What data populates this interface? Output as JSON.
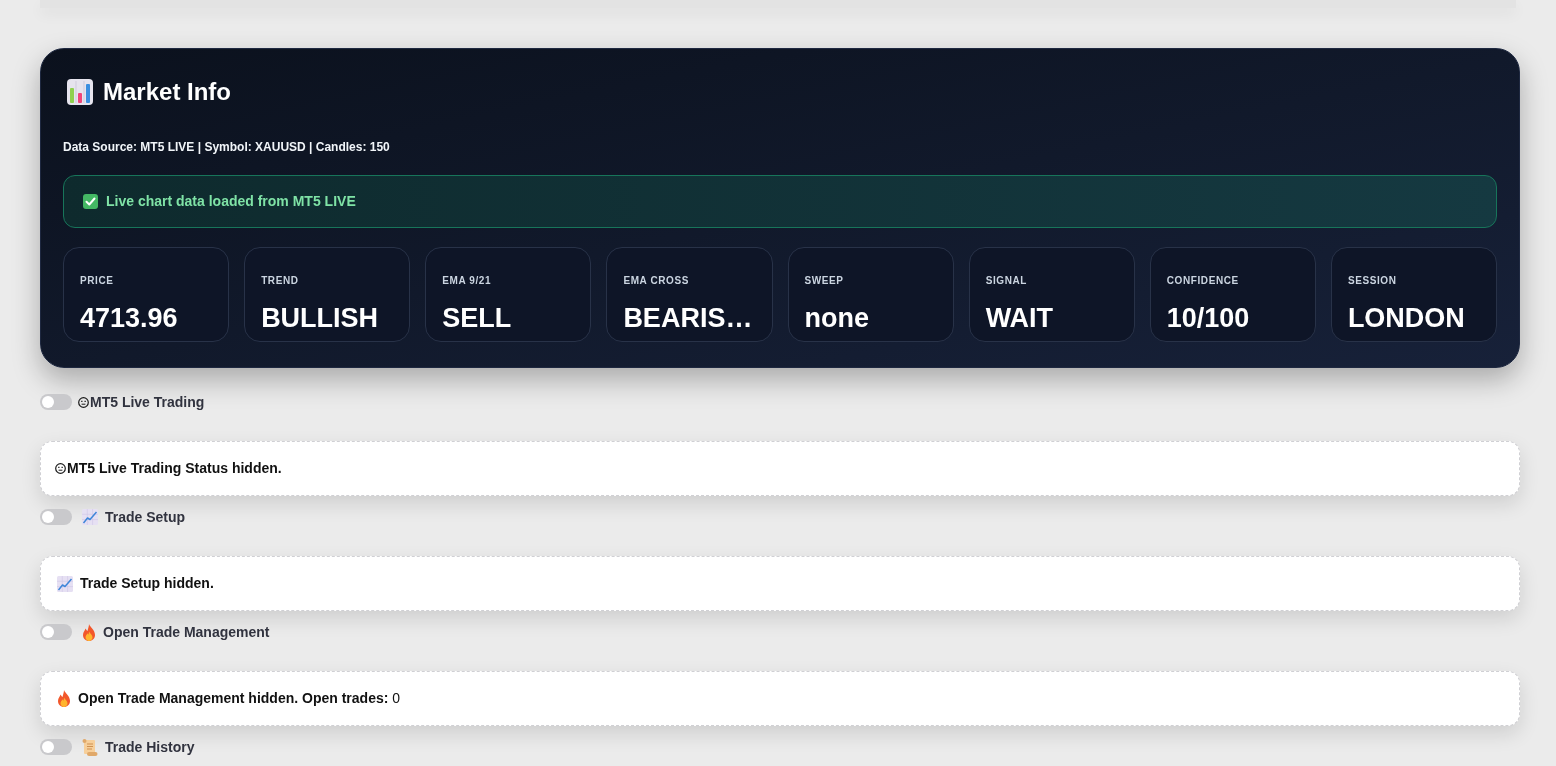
{
  "market_info": {
    "title": "Market Info",
    "meta": "Data Source: MT5 LIVE | Symbol: XAUUSD | Candles: 150",
    "alert": "Live chart data loaded from MT5 LIVE",
    "metrics": [
      {
        "label": "PRICE",
        "value": "4713.96"
      },
      {
        "label": "TREND",
        "value": "BULLISH"
      },
      {
        "label": "EMA 9/21",
        "value": "SELL"
      },
      {
        "label": "EMA CROSS",
        "value": "BEARIS…"
      },
      {
        "label": "SWEEP",
        "value": "none"
      },
      {
        "label": "SIGNAL",
        "value": "WAIT"
      },
      {
        "label": "CONFIDENCE",
        "value": "10/100"
      },
      {
        "label": "SESSION",
        "value": "LONDON"
      }
    ]
  },
  "sections": [
    {
      "toggle": {
        "label": "MT5 Live Trading",
        "on": false
      },
      "notice": {
        "text": "MT5 Live Trading Status hidden."
      }
    },
    {
      "toggle": {
        "label": "Trade Setup",
        "on": false
      },
      "notice": {
        "text": "Trade Setup hidden."
      }
    },
    {
      "toggle": {
        "label": "Open Trade Management",
        "on": false
      },
      "notice": {
        "text": "Open Trade Management hidden. Open trades:",
        "count": "0"
      }
    },
    {
      "toggle": {
        "label": "Trade History",
        "on": false
      }
    }
  ]
}
